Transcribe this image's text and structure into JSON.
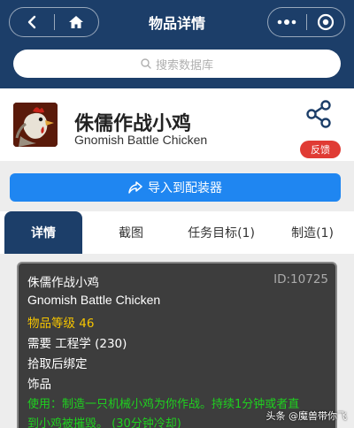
{
  "header": {
    "title": "物品详情",
    "search_placeholder": "搜索数据库"
  },
  "item": {
    "name_cn": "侏儒作战小鸡",
    "name_en": "Gnomish Battle Chicken",
    "feedback_label": "反馈"
  },
  "import_button": "导入到配装器",
  "tabs": [
    {
      "label": "详情"
    },
    {
      "label": "截图"
    },
    {
      "label": "任务目标(1)"
    },
    {
      "label": "制造(1)"
    }
  ],
  "tooltip": {
    "name_cn": "侏儒作战小鸡",
    "id": "ID:10725",
    "name_en": "Gnomish Battle Chicken",
    "item_level": "物品等级 46",
    "requires": "需要 工程学 (230)",
    "bind": "拾取后绑定",
    "slot": "饰品",
    "use_line1": "使用：制造一只机械小鸡为你作战。持续1分钟或者直",
    "use_line2": "到小鸡被摧毁。 (30分钟冷却)"
  },
  "watermark": "头条 @魔兽带你飞",
  "colors": {
    "header_bg": "#1c3e69",
    "accent_blue": "#1f86f1",
    "feedback_red": "#e03b34",
    "item_level_yellow": "#f5c400",
    "use_green": "#1fd11f",
    "tooltip_bg": "#3d3d3d"
  }
}
